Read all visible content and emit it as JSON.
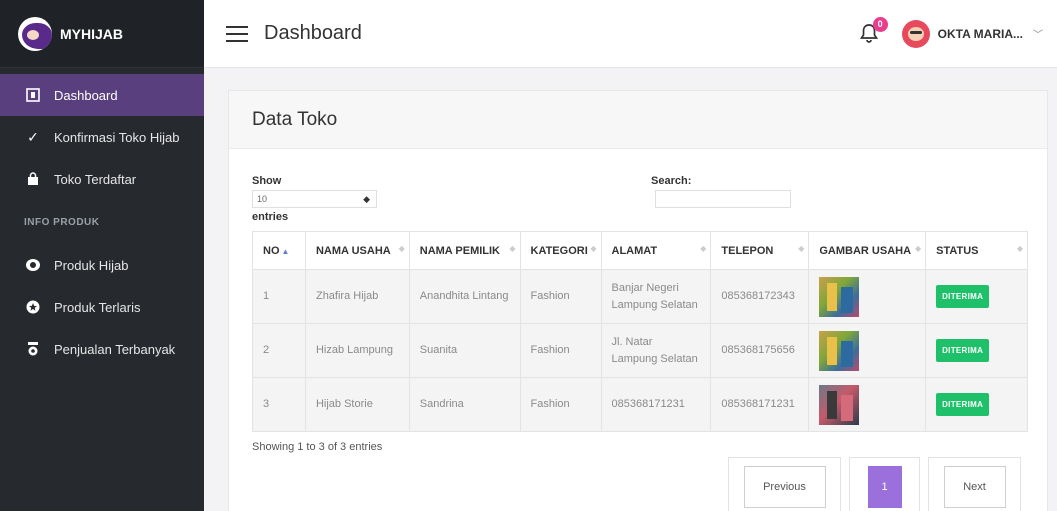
{
  "brand": {
    "name": "MYHIJAB"
  },
  "header": {
    "title": "Dashboard",
    "notification_count": "0",
    "user_name": "OKTA MARIA..."
  },
  "sidebar": {
    "items": [
      {
        "label": "Dashboard",
        "icon": "dashboard-icon",
        "active": true
      },
      {
        "label": "Konfirmasi Toko Hijab",
        "icon": "check-icon"
      },
      {
        "label": "Toko Terdaftar",
        "icon": "shop-bag-icon"
      }
    ],
    "section_label": "INFO PRODUK",
    "product_items": [
      {
        "label": "Produk Hijab",
        "icon": "hijab-icon"
      },
      {
        "label": "Produk Terlaris",
        "icon": "star-icon"
      },
      {
        "label": "Penjualan Terbanyak",
        "icon": "trophy-icon"
      }
    ]
  },
  "card": {
    "title": "Data Toko",
    "show_label": "Show",
    "show_value": "10",
    "entries_label": "entries",
    "search_label": "Search:"
  },
  "table": {
    "columns": [
      "NO",
      "NAMA USAHA",
      "NAMA PEMILIK",
      "KATEGORI",
      "ALAMAT",
      "TELEPON",
      "GAMBAR USAHA",
      "STATUS"
    ],
    "rows": [
      {
        "no": "1",
        "nama_usaha": "Zhafira Hijab",
        "nama_pemilik": "Anandhita Lintang",
        "kategori": "Fashion",
        "alamat": "Banjar Negeri Lampung Selatan",
        "telepon": "085368172343",
        "status": "DITERIMA"
      },
      {
        "no": "2",
        "nama_usaha": "Hizab Lampung",
        "nama_pemilik": "Suanita",
        "kategori": "Fashion",
        "alamat": "Jl. Natar Lampung Selatan",
        "telepon": "085368175656",
        "status": "DITERIMA"
      },
      {
        "no": "3",
        "nama_usaha": "Hijab Storie",
        "nama_pemilik": "Sandrina",
        "kategori": "Fashion",
        "alamat": "085368171231",
        "telepon": "085368171231",
        "status": "DITERIMA"
      }
    ]
  },
  "footer": {
    "info": "Showing 1 to 3 of 3 entries",
    "previous": "Previous",
    "page": "1",
    "next": "Next"
  },
  "colors": {
    "sidebar": "#26292e",
    "active": "#5a3f7f",
    "accent": "#9b6fdc",
    "success": "#1ec16a",
    "badge": "#e83e8c"
  }
}
